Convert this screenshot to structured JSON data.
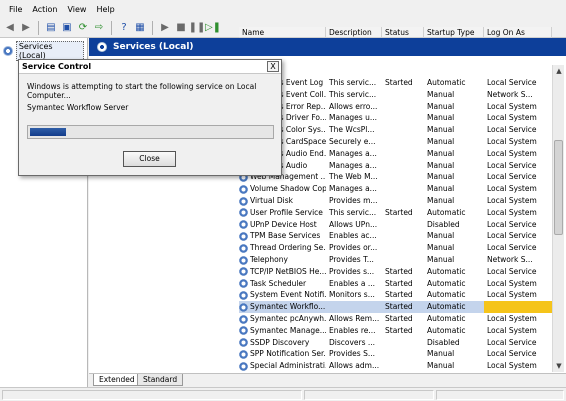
{
  "menu": {
    "items": [
      "File",
      "Action",
      "View",
      "Help"
    ]
  },
  "toolbar": {
    "icons": [
      "back-icon",
      "forward-icon",
      "console-tree-icon",
      "properties-icon",
      "refresh-icon",
      "export-icon",
      "help-icon",
      "show-hide-icon",
      "start-icon",
      "stop-icon",
      "pause-icon",
      "restart-icon"
    ]
  },
  "tree": {
    "item_label": "Services (Local)"
  },
  "header": {
    "title": "Services (Local)"
  },
  "columns": [
    "Name",
    "Description",
    "Status",
    "Startup Type",
    "Log On As"
  ],
  "rows": [
    {
      "name": "Windows Event Log",
      "description": "This servic...",
      "status": "Started",
      "startup": "Automatic",
      "logon": "Local Service"
    },
    {
      "name": "Windows Event Coll...",
      "description": "This servic...",
      "status": "",
      "startup": "Manual",
      "logon": "Network S..."
    },
    {
      "name": "Windows Error Rep...",
      "description": "Allows erro...",
      "status": "",
      "startup": "Manual",
      "logon": "Local System"
    },
    {
      "name": "Windows Driver Fo...",
      "description": "Manages u...",
      "status": "",
      "startup": "Manual",
      "logon": "Local System"
    },
    {
      "name": "Windows Color Sys...",
      "description": "The WcsPl...",
      "status": "",
      "startup": "Manual",
      "logon": "Local Service"
    },
    {
      "name": "Windows CardSpace",
      "description": "Securely e...",
      "status": "",
      "startup": "Manual",
      "logon": "Local System"
    },
    {
      "name": "Windows Audio End...",
      "description": "Manages a...",
      "status": "",
      "startup": "Manual",
      "logon": "Local System"
    },
    {
      "name": "Windows Audio",
      "description": "Manages a...",
      "status": "",
      "startup": "Manual",
      "logon": "Local Service"
    },
    {
      "name": "Web Management ...",
      "description": "The Web M...",
      "status": "",
      "startup": "Manual",
      "logon": "Local Service"
    },
    {
      "name": "Volume Shadow Copy",
      "description": "Manages a...",
      "status": "",
      "startup": "Manual",
      "logon": "Local System"
    },
    {
      "name": "Virtual Disk",
      "description": "Provides m...",
      "status": "",
      "startup": "Manual",
      "logon": "Local System"
    },
    {
      "name": "User Profile Service",
      "description": "This servic...",
      "status": "Started",
      "startup": "Automatic",
      "logon": "Local System"
    },
    {
      "name": "UPnP Device Host",
      "description": "Allows UPn...",
      "status": "",
      "startup": "Disabled",
      "logon": "Local Service"
    },
    {
      "name": "TPM Base Services",
      "description": "Enables ac...",
      "status": "",
      "startup": "Manual",
      "logon": "Local Service"
    },
    {
      "name": "Thread Ordering Se...",
      "description": "Provides or...",
      "status": "",
      "startup": "Manual",
      "logon": "Local Service"
    },
    {
      "name": "Telephony",
      "description": "Provides T...",
      "status": "",
      "startup": "Manual",
      "logon": "Network S..."
    },
    {
      "name": "TCP/IP NetBIOS He...",
      "description": "Provides s...",
      "status": "Started",
      "startup": "Automatic",
      "logon": "Local Service"
    },
    {
      "name": "Task Scheduler",
      "description": "Enables a ...",
      "status": "Started",
      "startup": "Automatic",
      "logon": "Local System"
    },
    {
      "name": "System Event Notifi...",
      "description": "Monitors s...",
      "status": "Started",
      "startup": "Automatic",
      "logon": "Local System"
    },
    {
      "name": "Symantec Workflo...",
      "description": "",
      "status": "Started",
      "startup": "Automatic",
      "logon": "",
      "selected": true
    },
    {
      "name": "Symantec pcAnywh...",
      "description": "Allows Rem...",
      "status": "Started",
      "startup": "Automatic",
      "logon": "Local System"
    },
    {
      "name": "Symantec Manage...",
      "description": "Enables re...",
      "status": "Started",
      "startup": "Automatic",
      "logon": "Local System"
    },
    {
      "name": "SSDP Discovery",
      "description": "Discovers ...",
      "status": "",
      "startup": "Disabled",
      "logon": "Local Service"
    },
    {
      "name": "SPP Notification Ser...",
      "description": "Provides S...",
      "status": "",
      "startup": "Manual",
      "logon": "Local Service"
    },
    {
      "name": "Special Administrati...",
      "description": "Allows adm...",
      "status": "",
      "startup": "Manual",
      "logon": "Local System"
    }
  ],
  "tabs": [
    "Extended",
    "Standard"
  ],
  "dialog": {
    "title": "Service Control",
    "message": "Windows is attempting to start the following service on Local Computer...",
    "service_name": "Symantec Workflow Server",
    "progress": 0.15,
    "close_label": "Close",
    "close_glyph": "X"
  },
  "colors": {
    "header_bg": "#0d3f9a",
    "selected_row": "#c4d4ec",
    "logon_highlight": "#f5c41a",
    "progress_fill": "#1e4c98"
  }
}
